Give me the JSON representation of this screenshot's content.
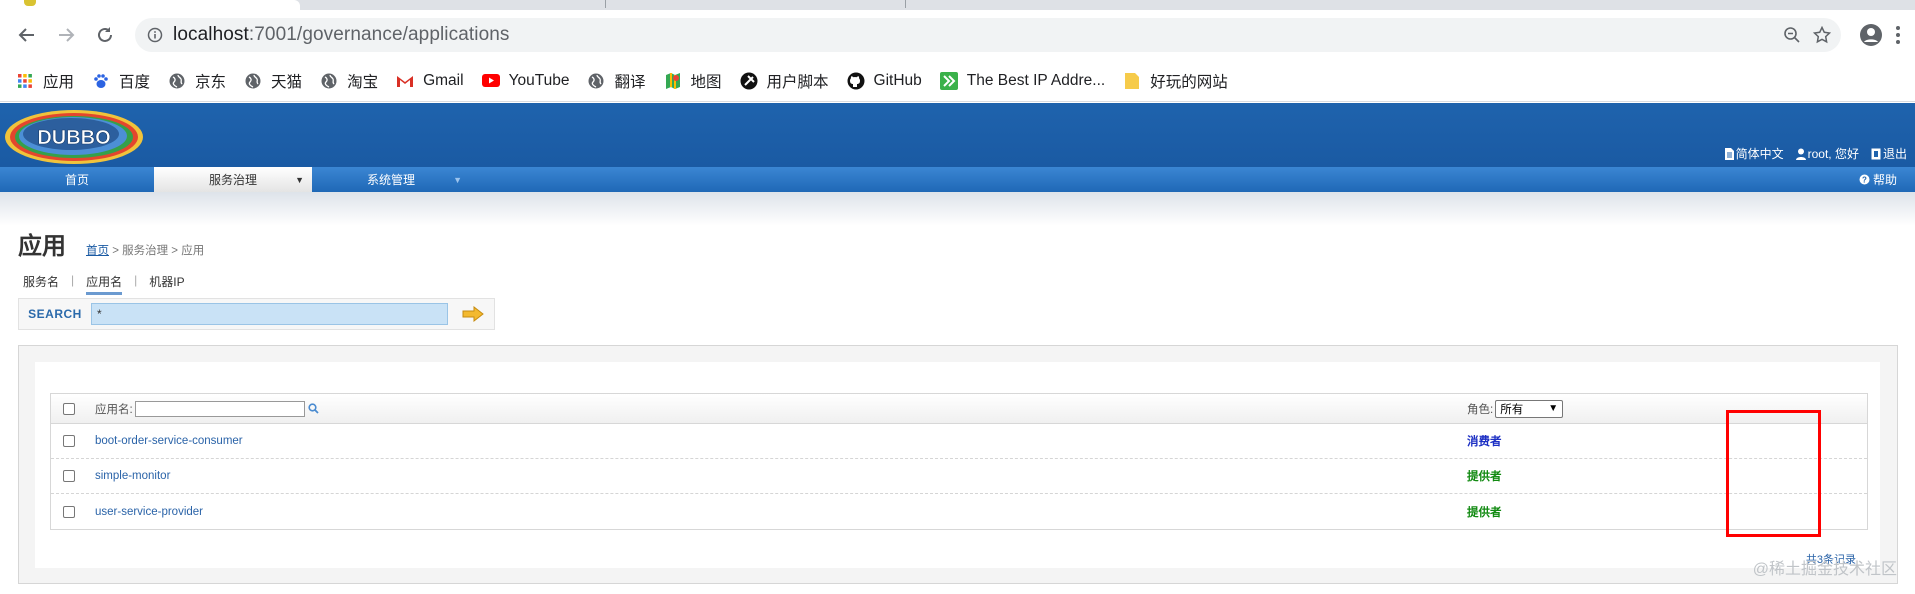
{
  "browser": {
    "url_host": "localhost",
    "url_path": ":7001/governance/applications",
    "bookmarks": [
      {
        "icon": "apps-grid-icon",
        "label": "应用"
      },
      {
        "icon": "baidu-paw-icon",
        "label": "百度"
      },
      {
        "icon": "globe-icon",
        "label": "京东"
      },
      {
        "icon": "globe-icon",
        "label": "天猫"
      },
      {
        "icon": "globe-icon",
        "label": "淘宝"
      },
      {
        "icon": "gmail-icon",
        "label": "Gmail"
      },
      {
        "icon": "youtube-icon",
        "label": "YouTube"
      },
      {
        "icon": "globe-icon",
        "label": "翻译"
      },
      {
        "icon": "maps-icon",
        "label": "地图"
      },
      {
        "icon": "userscript-icon",
        "label": "用户脚本"
      },
      {
        "icon": "github-icon",
        "label": "GitHub"
      },
      {
        "icon": "ip-arrows-icon",
        "label": "The Best IP Addre..."
      },
      {
        "icon": "folder-icon",
        "label": "好玩的网站"
      }
    ]
  },
  "header": {
    "logo_text": "DUBBO",
    "lang": "简体中文",
    "user": "root, 您好",
    "logout": "退出"
  },
  "menu": {
    "home": "首页",
    "service_gov": "服务治理",
    "system_mgmt": "系统管理",
    "help": "帮助"
  },
  "page": {
    "title": "应用",
    "breadcrumb_home": "首页",
    "breadcrumb_rest": " > 服务治理 > 应用",
    "subtabs": [
      "服务名",
      "应用名",
      "机器IP"
    ],
    "search_label": "SEARCH",
    "search_value": "*"
  },
  "table": {
    "filter_label": "应用名:",
    "role_label": "角色:",
    "role_selected": "所有",
    "rows": [
      {
        "name": "boot-order-service-consumer",
        "role": "消费者",
        "role_color": "#1c2fc4"
      },
      {
        "name": "simple-monitor",
        "role": "提供者",
        "role_color": "#118a11"
      },
      {
        "name": "user-service-provider",
        "role": "提供者",
        "role_color": "#118a11"
      }
    ],
    "total": "共3条记录"
  },
  "watermark": "@稀土掘金技术社区",
  "colors": {
    "banner": "#1f63ad",
    "menubar": "#2a74c2",
    "highlight_box": "#ff0000"
  }
}
